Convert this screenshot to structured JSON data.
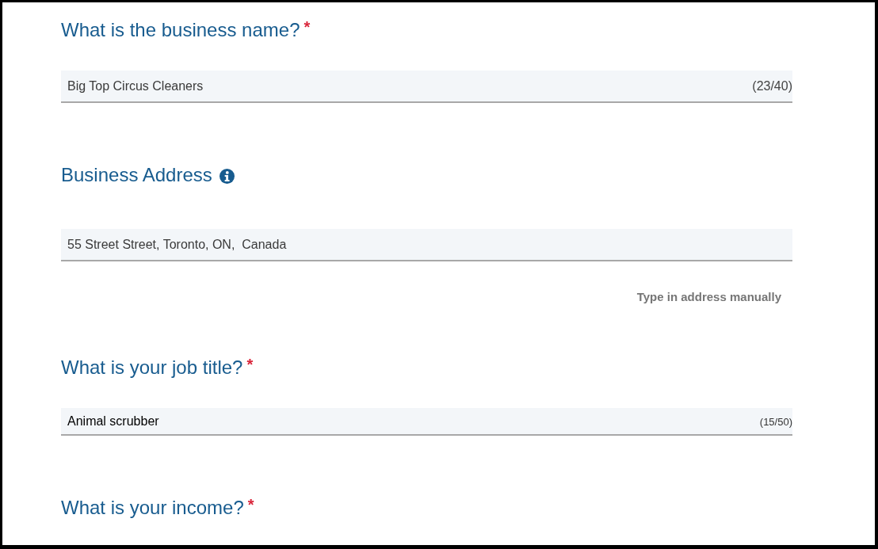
{
  "questions": [
    {
      "label": "What is the business name?",
      "required_mark": "*",
      "info": false,
      "field": {
        "kind": "standard",
        "value": "Big Top Circus Cleaners",
        "counter": "(23/40)"
      }
    },
    {
      "label": "Business Address",
      "info": true,
      "field": {
        "kind": "standard",
        "value": "55 Street Street, Toronto, ON,  Canada"
      },
      "link": "Type in address manually"
    },
    {
      "label": "What is your job title?",
      "required_mark": "*",
      "info": false,
      "field": {
        "kind": "compact",
        "value": "Animal scrubber",
        "counter": "(15/50)"
      }
    },
    {
      "label": "What is your income?",
      "required_mark": "*",
      "info": false
    }
  ]
}
